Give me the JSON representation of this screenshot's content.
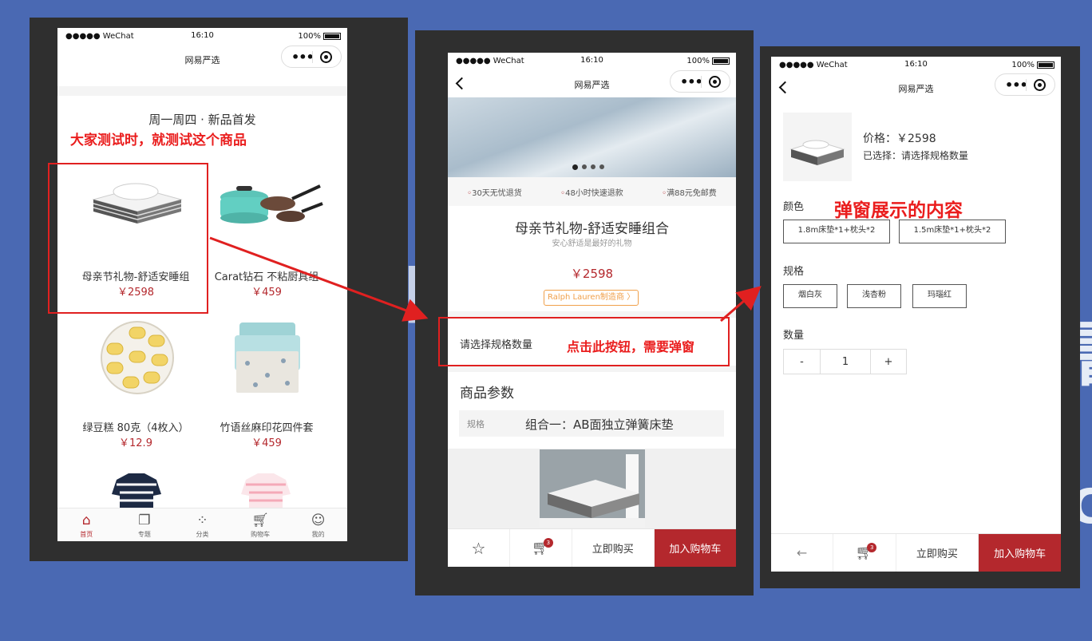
{
  "statusbar": {
    "carrier": "●●●●● WeChat",
    "time": "16:10",
    "battery": "100%"
  },
  "nav": {
    "title": "网易严选",
    "capsule_more": "•••"
  },
  "home": {
    "section_title": "周一周四 · 新品首发",
    "annotation": "大家测试时，就测试这个商品",
    "products": [
      {
        "name": "母亲节礼物-舒适安睡组",
        "price": "￥2598"
      },
      {
        "name": "Carat钻石 不粘厨具组",
        "price": "￥459"
      },
      {
        "name": "绿豆糕 80克（4枚入）",
        "price": "￥12.9"
      },
      {
        "name": "竹语丝麻印花四件套",
        "price": "￥459"
      }
    ],
    "tabs": [
      {
        "label": "首页",
        "icon": "home-icon"
      },
      {
        "label": "专题",
        "icon": "topic-icon"
      },
      {
        "label": "分类",
        "icon": "category-icon"
      },
      {
        "label": "购物车",
        "icon": "cart-icon"
      },
      {
        "label": "我的",
        "icon": "user-icon"
      }
    ]
  },
  "detail": {
    "services": [
      "30天无忧退货",
      "48小时快速退款",
      "满88元免邮费"
    ],
    "title": "母亲节礼物-舒适安睡组合",
    "subtitle": "安心舒适是最好的礼物",
    "price": "￥2598",
    "brand_tag": "Ralph Lauren制造商 〉",
    "select_spec": "请选择规格数量",
    "annotation": "点击此按钮，需要弹窗",
    "params_title": "商品参数",
    "param_key": "规格",
    "param_value": "组合一：AB面独立弹簧床垫"
  },
  "popup": {
    "price": "价格：￥2598",
    "selected": "已选择：请选择规格数量",
    "annotation": "弹窗展示的内容",
    "color_label": "颜色",
    "colors": [
      "1.8m床垫*1+枕头*2",
      "1.5m床垫*1+枕头*2"
    ],
    "spec_label": "规格",
    "specs": [
      "烟白灰",
      "浅杏粉",
      "玛瑙红"
    ],
    "qty_label": "数量",
    "qty_minus": "-",
    "qty_value": "1",
    "qty_plus": "+"
  },
  "bottom_bar": {
    "buy_now": "立即购买",
    "add_cart": "加入购物车",
    "cart_count": "3"
  }
}
